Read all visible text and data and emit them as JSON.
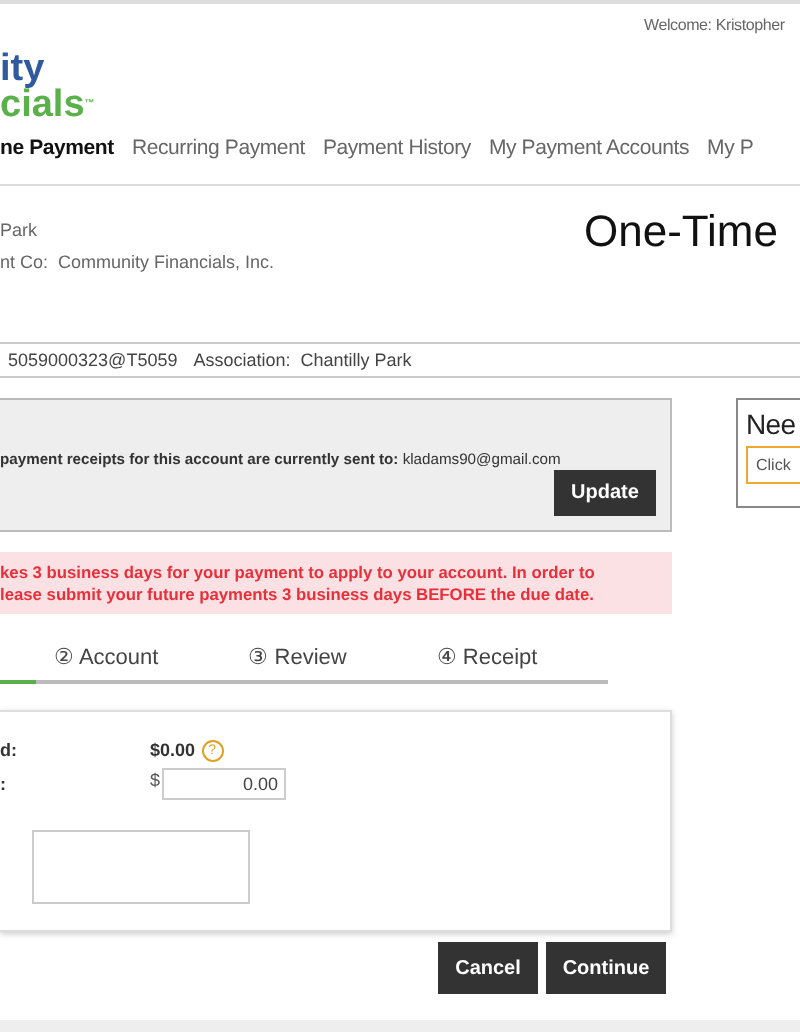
{
  "header": {
    "welcome": "Welcome: Kristopher",
    "logo_top": "ity",
    "logo_bottom": "cials",
    "logo_mark": "™"
  },
  "nav": [
    {
      "label": "ne Payment",
      "selected": true
    },
    {
      "label": "Recurring Payment",
      "selected": false
    },
    {
      "label": "Payment History",
      "selected": false
    },
    {
      "label": "My Payment Accounts",
      "selected": false
    },
    {
      "label": "My P",
      "selected": false
    }
  ],
  "association": {
    "name": "Park",
    "mgmt_label": "nt Co:",
    "mgmt_value": "Community Financials, Inc."
  },
  "page_title": "One-Time",
  "account_bar": {
    "account": "5059000323@T5059",
    "association_label": "Association:",
    "association_value": "Chantilly Park"
  },
  "receipt_box": {
    "text": "payment receipts for this account are currently sent to:",
    "email": "kladams90@gmail.com",
    "button": "Update"
  },
  "help_box": {
    "title": "Nee",
    "button": "Click"
  },
  "notice": [
    "kes 3 business days for your payment to apply to your account. In order to",
    "lease submit your future payments 3 business days BEFORE the due date."
  ],
  "steps": [
    {
      "label": "② Account",
      "selected": false
    },
    {
      "label": "③ Review",
      "selected": false
    },
    {
      "label": "④ Receipt",
      "selected": false
    }
  ],
  "progress": {
    "level": 0.06
  },
  "form": {
    "due_label": "d:",
    "due_value": "$0.00",
    "help": "?",
    "amount_label": ":",
    "currency": "$",
    "amount_value": "0.00"
  },
  "buttons": [
    {
      "label": "Cancel"
    },
    {
      "label": "Continue"
    }
  ]
}
